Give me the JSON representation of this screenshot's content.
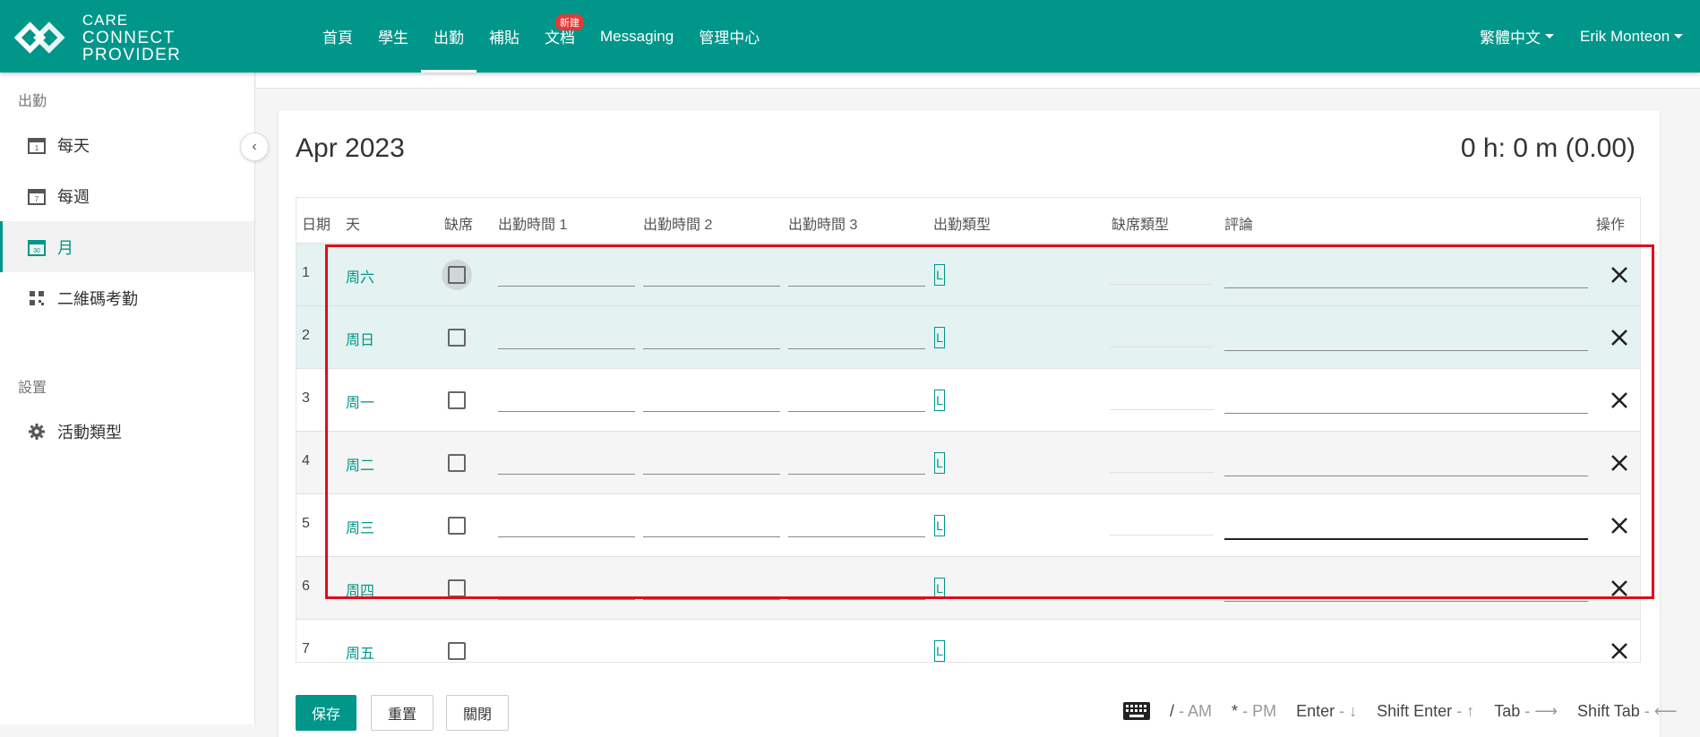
{
  "brand": {
    "line1": "CARE",
    "line2": "CONNECT PROVIDER"
  },
  "nav": {
    "items": [
      {
        "label": "首頁"
      },
      {
        "label": "學生"
      },
      {
        "label": "出勤"
      },
      {
        "label": "補貼"
      },
      {
        "label": "文档",
        "badge": "新建"
      },
      {
        "label": "Messaging"
      },
      {
        "label": "管理中心"
      }
    ],
    "active_index": 2,
    "language": "繁體中文",
    "user": "Erik Monteon"
  },
  "sidebar": {
    "section1": "出勤",
    "items": [
      {
        "label": "每天",
        "icon": "calendar-day-icon",
        "badge": "1"
      },
      {
        "label": "每週",
        "icon": "calendar-week-icon",
        "badge": "7"
      },
      {
        "label": "月",
        "icon": "calendar-month-icon",
        "badge": "30",
        "active": true
      },
      {
        "label": "二維碼考勤",
        "icon": "qr-code-icon"
      }
    ],
    "section2": "設置",
    "items2": [
      {
        "label": "活動類型",
        "icon": "gear-icon"
      }
    ]
  },
  "card": {
    "title": "Apr 2023",
    "total": "0 h: 0 m (0.00)"
  },
  "table": {
    "headers": {
      "date": "日期",
      "day": "天",
      "absent": "缺席",
      "time1": "出勤時間 1",
      "time2": "出勤時間 2",
      "time3": "出勤時間 3",
      "type": "出勤類型",
      "absent_type": "缺席類型",
      "comment": "評論",
      "action": "操作"
    },
    "rows": [
      {
        "num": "1",
        "day": "周六",
        "type": "L"
      },
      {
        "num": "2",
        "day": "周日",
        "type": "L"
      },
      {
        "num": "3",
        "day": "周一",
        "type": "L"
      },
      {
        "num": "4",
        "day": "周二",
        "type": "L"
      },
      {
        "num": "5",
        "day": "周三",
        "type": "L"
      },
      {
        "num": "6",
        "day": "周四",
        "type": "L"
      },
      {
        "num": "7",
        "day": "周五",
        "type": "L"
      }
    ]
  },
  "footer": {
    "save": "保存",
    "reset": "重置",
    "close": "關閉",
    "shortcuts": [
      {
        "key": "/",
        "desc": "- AM"
      },
      {
        "key": "*",
        "desc": "- PM"
      },
      {
        "key": "Enter",
        "desc": "- ↓"
      },
      {
        "key": "Shift Enter",
        "desc": "- ↑"
      },
      {
        "key": "Tab",
        "desc": "- ⟶"
      },
      {
        "key": "Shift Tab",
        "desc": "- ⟵"
      }
    ]
  },
  "colors": {
    "primary": "#00968a",
    "highlight": "#e00d1b",
    "selected_row": "#e4f2f1"
  }
}
